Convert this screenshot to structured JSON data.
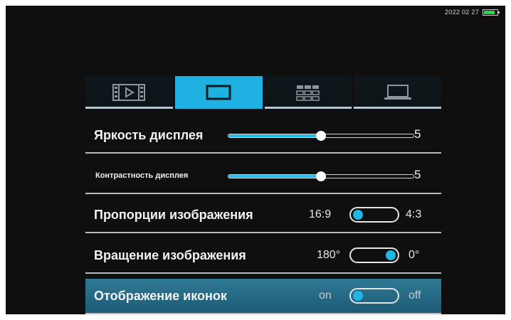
{
  "status_bar": {
    "date": "2022 02 27",
    "battery_level": 0.75,
    "battery_color": "#21d74a"
  },
  "tabs": [
    {
      "icon": "video-icon",
      "active": false
    },
    {
      "icon": "screen-icon",
      "active": true
    },
    {
      "icon": "grid-icon",
      "active": false
    },
    {
      "icon": "laptop-icon",
      "active": false
    }
  ],
  "accent_color": "#1fb1e2",
  "settings": {
    "brightness": {
      "label": "Яркость дисплея",
      "value": "5",
      "level": 0.5
    },
    "contrast": {
      "label": "Контрастность дисплея",
      "value": "5",
      "level": 0.5
    },
    "aspect": {
      "label": "Пропорции изображения",
      "option_a": "16:9",
      "option_b": "4:3",
      "selected": "16:9"
    },
    "rotation": {
      "label": "Вращение изображения",
      "option_a": "180°",
      "option_b": "0°",
      "selected": "0°"
    },
    "icons": {
      "label": "Отображение иконок",
      "option_a": "on",
      "option_b": "off",
      "selected": "on"
    }
  }
}
